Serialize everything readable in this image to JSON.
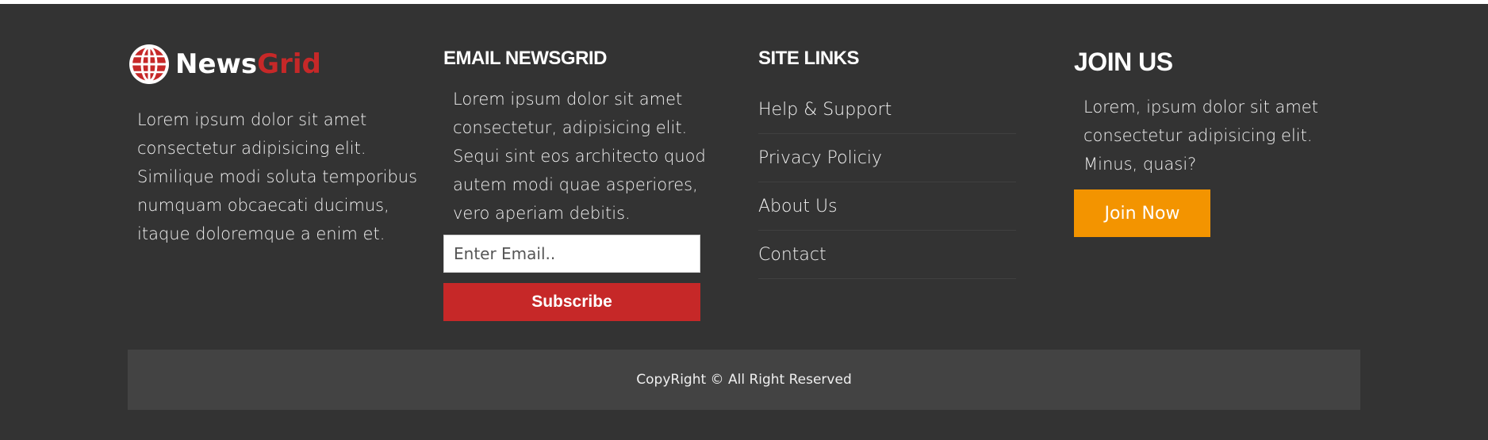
{
  "brand": {
    "name_part1": "News",
    "name_part2": "Grid",
    "logo_icon": "globe-icon",
    "description": "Lorem ipsum dolor sit amet consectetur adipisicing elit. Similique modi soluta temporibus numquam obcaecati ducimus, itaque doloremque a enim et."
  },
  "email_section": {
    "heading": "EMAIL NEWSGRID",
    "description": "Lorem ipsum dolor sit amet consectetur, adipisicing elit. Sequi sint eos architecto quod autem modi quae asperiores, vero aperiam debitis.",
    "input_placeholder": "Enter Email..",
    "input_value": "",
    "subscribe_label": "Subscribe"
  },
  "site_links": {
    "heading": "SITE LINKS",
    "items": [
      {
        "label": "Help & Support"
      },
      {
        "label": "Privacy Policiy"
      },
      {
        "label": "About Us"
      },
      {
        "label": "Contact"
      }
    ]
  },
  "join": {
    "heading": "JOIN US",
    "description": "Lorem, ipsum dolor sit amet consectetur adipisicing elit. Minus, quasi?",
    "button_label": "Join Now"
  },
  "copyright": {
    "text": "CopyRight © All Right Reserved"
  },
  "colors": {
    "footer_bg": "#333333",
    "copyright_bg": "#434343",
    "brand_red": "#c62828",
    "join_orange": "#f39400"
  }
}
